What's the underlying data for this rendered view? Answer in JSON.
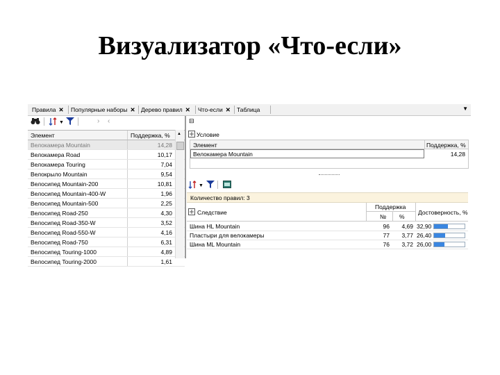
{
  "slide": {
    "title": "Визуализатор «Что-если»"
  },
  "tabs": [
    {
      "label": "Правила",
      "close": "✕"
    },
    {
      "label": "Популярные наборы",
      "close": "✕"
    },
    {
      "label": "Дерево правил",
      "close": "✕"
    },
    {
      "label": "Что-если",
      "close": "✕"
    },
    {
      "label": "Таблица",
      "close": ""
    }
  ],
  "tab_menu": "▼",
  "left_toolbar": {
    "icons": [
      "binoculars-icon",
      "sort-icon",
      "filter-icon",
      "next-icon",
      "prev-icon"
    ]
  },
  "left_grid": {
    "col_element": "Элемент",
    "col_support": "Поддержка, %",
    "rows": [
      {
        "name": "Велокамера Mountain",
        "value": "14,28"
      },
      {
        "name": "Велокамера Road",
        "value": "10,17"
      },
      {
        "name": "Велокамера Touring",
        "value": "7,04"
      },
      {
        "name": "Велокрыло Mountain",
        "value": "9,54"
      },
      {
        "name": "Велосипед Mountain-200",
        "value": "10,81"
      },
      {
        "name": "Велосипед Mountain-400-W",
        "value": "1,96"
      },
      {
        "name": "Велосипед Mountain-500",
        "value": "2,25"
      },
      {
        "name": "Велосипед Road-250",
        "value": "4,30"
      },
      {
        "name": "Велосипед Road-350-W",
        "value": "3,52"
      },
      {
        "name": "Велосипед Road-550-W",
        "value": "4,16"
      },
      {
        "name": "Велосипед Road-750",
        "value": "6,31"
      },
      {
        "name": "Велосипед Touring-1000",
        "value": "4,89"
      },
      {
        "name": "Велосипед Touring-2000",
        "value": "1,61"
      }
    ]
  },
  "condition": {
    "header": "Условие",
    "col_element": "Элемент",
    "col_support": "Поддержка, %",
    "row_name": "Велокамера Mountain",
    "row_value": "14,28"
  },
  "rules": {
    "count_label": "Количество правил: 3",
    "col_consequent": "Следствие",
    "col_support": "Поддержка",
    "col_num": "№",
    "col_pct": "%",
    "col_confidence": "Достоверность, %",
    "rows": [
      {
        "name": "Шина HL Mountain",
        "num": "96",
        "pct": "4,69",
        "conf": "32,90",
        "conf_value": 32.9
      },
      {
        "name": "Пластыри для велокамеры",
        "num": "77",
        "pct": "3,77",
        "conf": "26,40",
        "conf_value": 26.4
      },
      {
        "name": "Шина ML Mountain",
        "num": "76",
        "pct": "3,72",
        "conf": "26,00",
        "conf_value": 26.0
      }
    ]
  },
  "colors": {
    "bar": "#3a86e0",
    "count_bar_bg": "#fbf3de"
  }
}
